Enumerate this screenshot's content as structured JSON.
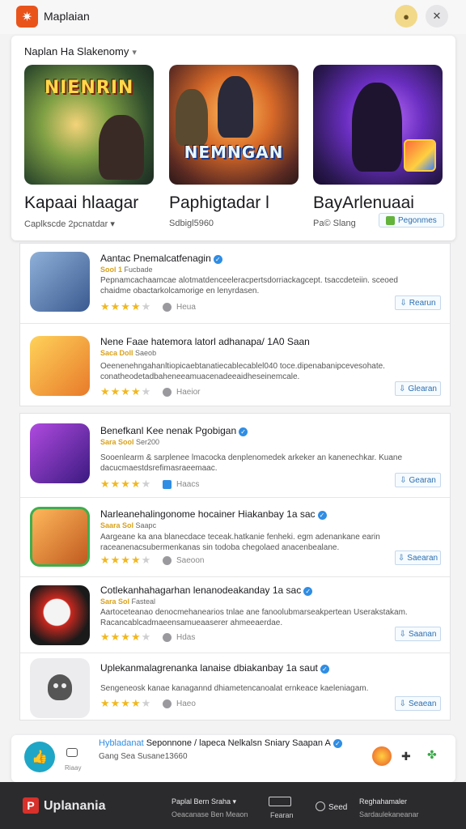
{
  "header": {
    "app_title": "Maplaian",
    "logo_icon": "✷",
    "avatar_icon": "person-icon",
    "menu_icon": "x-icon"
  },
  "featured": {
    "heading": "Naplan Ha Slakenomy",
    "cards": [
      {
        "logo_text": "NIENRIN",
        "title": "Kapaai hlaagar",
        "subtitle": "Caplkscde 2pcnatdar ▾"
      },
      {
        "logo_text": "NEMNGAN",
        "title": "Paphigtadar l",
        "subtitle": "Sdbigl5960"
      },
      {
        "logo_text": "",
        "title": "BayArlenuaai",
        "subtitle": "Pa© Slang",
        "button_label": "Pegonmes"
      }
    ]
  },
  "list_primary": [
    {
      "title": "Aantac Pnemalcatfenagin",
      "meta_hl": "Sool 1",
      "meta_rest": "Fucbade",
      "desc": "Pepnamcachaamcae alotmatdenceeleracpertsdorriackagcept. tsaccdeteiin. sceoed chaidme obactarkolcamorige en lenyrdasen.",
      "rating": 4,
      "user": "Heua",
      "button": "Rearun",
      "icon": "blaster-game-icon"
    },
    {
      "title": "Nene Faae hatemora latorl adhanapa/ 1A0 Saan",
      "meta_hl": "Saca Doll",
      "meta_rest": "Saeob",
      "desc": "Oeenenehngahanltiopicaebtanatiecablecablel040 toce.dipenabanipcevesohate. conatheodetadbaheneeamuacenadeeaidheseinemcale.",
      "rating": 4,
      "user": "Haeior",
      "button": "Glearan",
      "icon": "brawler-game-icon"
    }
  ],
  "list_secondary": [
    {
      "title": "Benefkanl Kee nenak Pgobigan",
      "meta_hl": "Sara Sool",
      "meta_rest": "Ser200",
      "desc": "Sooenlearm & sarplenee lmacocka denplenomedek arkeker an kanenechkar. Kuane dacucmaestdsrefimasraeemaac.",
      "rating": 4,
      "user": "Haacs",
      "user_blue": true,
      "button": "Gearan",
      "icon": "arcane-game-icon"
    },
    {
      "title": "Narleanehalingonome hocainer Hiakanbay 1a sac",
      "meta_hl": "Saara Sol",
      "meta_rest": "Saapc",
      "desc": "Aargeane ka ana blanecdace teceak.hatkanie fenheki. egm adenankane earin raceanenacsubermenkanas sin todoba chegolaed anacenbealane.",
      "rating": 4,
      "user": "Saeoon",
      "button": "Saearan",
      "icon": "hero-game-icon"
    },
    {
      "title": "Cotlekanhahagarhan lenanodeakanday 1a sac",
      "meta_hl": "Sara Sol",
      "meta_rest": "Fasteal",
      "desc": "Aartoceteanao denocmehanearios tnlae ane fanoolubmarseakpertean Userakstakam. Racancablcadmaeensamueaaserer ahmeeaerdae.",
      "rating": 4,
      "user": "Hdas",
      "button": "Saanan",
      "icon": "skull-game-icon"
    },
    {
      "title": "Uplekanmalagrenanka lanaise dbiakanbay 1a saut",
      "meta_hl": "",
      "meta_rest": "",
      "desc": "Sengeneosk kanae kanagannd dhiametencanoalat ernkeace kaeleniagam.",
      "rating": 4,
      "user": "Haeo",
      "button": "Seaean",
      "icon": "ghost-game-icon"
    }
  ],
  "mini_bar": {
    "title_blue": "Hybladanat",
    "title_rest": "Seponnone / lapeca Nelkalsn Sniary Saapan A",
    "subtitle": "Gang Sea Susane13660",
    "caption": "Riaay"
  },
  "footer": {
    "brand": "Uplanania",
    "col1_line1": "Paplal Bern Sraha ▾",
    "col1_line2": "Oeacanase Ben Meaon",
    "kbd_caption": "Fearan",
    "copy_text": "Seed",
    "col3_line1": "Reghahamaler",
    "col3_line2": "Sardaulekaneanar"
  },
  "colors": {
    "accent": "#2f8de4",
    "brand": "#e9541b",
    "star": "#f1b821",
    "footer_bg": "#2b2b2e"
  }
}
